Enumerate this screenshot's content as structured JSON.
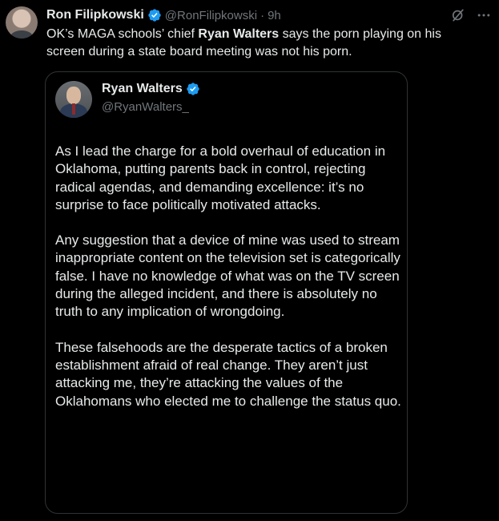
{
  "tweet": {
    "author_name": "Ron Filipkowski",
    "author_handle": "@RonFilipkowski",
    "separator": "·",
    "time": "9h",
    "text_before": "OK’s MAGA schools’ chief ",
    "text_bold": "Ryan Walters",
    "text_after": " says the porn playing on his screen during a state board meeting was not his porn.",
    "actions": {
      "grok_icon": "grok-icon",
      "more_icon": "more-icon",
      "more_label": "···"
    }
  },
  "quoted_tweet": {
    "author_name": "Ryan Walters",
    "author_handle": "@RyanWalters_",
    "paragraphs": [
      "As I lead the charge for a bold overhaul of education in Oklahoma, putting parents back in control, rejecting radical agendas, and demanding excellence: it’s no surprise to face politically motivated attacks.",
      "Any suggestion that a device of mine was used to stream inappropriate content on the television set is categorically false. I have no knowledge of what was on the TV screen during the alleged incident, and there is absolutely no truth to any implication of wrongdoing.",
      "These falsehoods are the desperate tactics of a broken establishment afraid of real change. They aren’t just attacking me, they’re attacking the values of the Oklahomans who elected me to challenge the status quo."
    ]
  },
  "colors": {
    "background": "#000000",
    "text": "#e7e9ea",
    "muted": "#71767b",
    "verified": "#1d9bf0",
    "border": "#2f3336"
  }
}
